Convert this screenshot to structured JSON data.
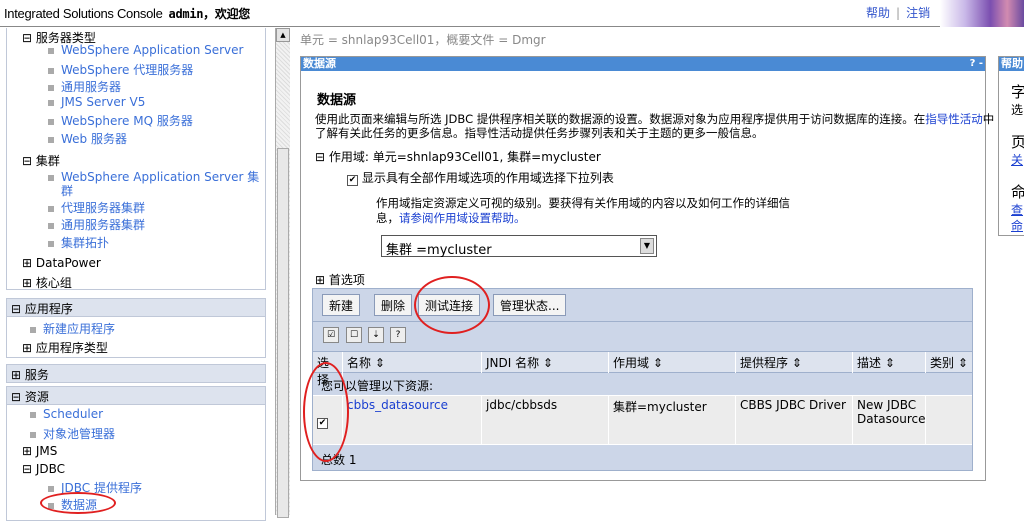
{
  "header": {
    "app_title": "Integrated Solutions Console",
    "user": "admin，欢迎您",
    "help": "帮助",
    "sep": "|",
    "logout": "注销"
  },
  "nav": {
    "server_types": "服务器类型",
    "server_items": [
      "WebSphere Application Server",
      "WebSphere 代理服务器",
      "通用服务器",
      "JMS Server V5",
      "WebSphere MQ 服务器",
      "Web 服务器"
    ],
    "clusters": "集群",
    "cluster_items": [
      "WebSphere Application Server 集",
      "群",
      "代理服务器集群",
      "通用服务器集群",
      "集群拓扑"
    ],
    "datapower": "DataPower",
    "core_groups": "核心组",
    "applications": "应用程序",
    "new_app": "新建应用程序",
    "app_types": "应用程序类型",
    "services": "服务",
    "resources": "资源",
    "scheduler": "Scheduler",
    "object_pool": "对象池管理器",
    "jms": "JMS",
    "jdbc": "JDBC",
    "jdbc_providers": "JDBC 提供程序",
    "datasources": "数据源"
  },
  "breadcrumb": "单元 = shnlap93Cell01，概要文件 = Dmgr",
  "panel": {
    "title": "数据源",
    "controls": "? -",
    "heading": "数据源",
    "desc1": "使用此页面来编辑与所选 JDBC 提供程序相关联的数据源的设置。数据源对象为应用程序提供用于访问数据库的连接。在",
    "guided_link": "指导性活动",
    "desc1_end": "中",
    "desc2": "了解有关此任务的更多信息。指导性活动提供任务步骤列表和关于主题的更多一般信息。",
    "scope_label": "作用域: 单元=shnlap93Cell01, 集群=mycluster",
    "show_scope_checkbox": "显示具有全部作用域选项的作用域选择下拉列表",
    "scope_help1": "作用域指定资源定义可视的级别。要获得有关作用域的内容以及如何工作的详细信",
    "scope_help2": "息，",
    "scope_help_link": "请参阅作用域设置帮助。",
    "scope_value": "集群 =mycluster",
    "preferences": "首选项",
    "buttons": {
      "new": "新建",
      "delete": "删除",
      "test": "测试连接",
      "manage": "管理状态..."
    },
    "columns": [
      "选择",
      "名称 ⇕",
      "JNDI 名称 ⇕",
      "作用域 ⇕",
      "提供程序 ⇕",
      "描述 ⇕",
      "类别 ⇕"
    ],
    "manage_note": "您可以管理以下资源:",
    "rows": [
      {
        "name": "cbbs_datasource",
        "jndi": "jdbc/cbbsds",
        "scope": "集群=mycluster",
        "provider": "CBBS JDBC Driver",
        "desc1": "New JDBC",
        "desc2": "Datasource",
        "category": ""
      }
    ],
    "total": "总数 1"
  },
  "help": {
    "title": "帮助",
    "t1": "字",
    "t2": "选",
    "p": "页",
    "l1": "关",
    "c": "命",
    "l2": "查",
    "l3": "命"
  }
}
